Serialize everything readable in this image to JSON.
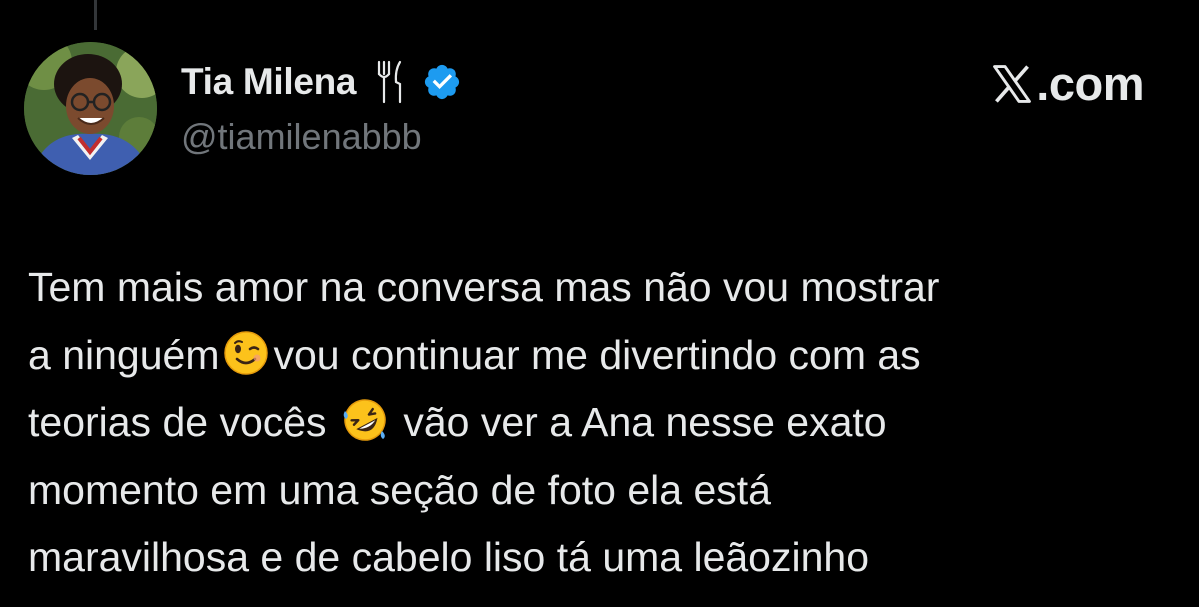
{
  "tweet": {
    "author": {
      "display_name": "Tia Milena",
      "name_emoji": "fork-and-knife-icon",
      "verified": true,
      "handle": "@tiamilenabbb",
      "avatar": "profile-photo"
    },
    "brand": {
      "label": ".com",
      "logo": "x-logo-icon"
    },
    "text_lines": {
      "line1": "Tem mais amor na conversa mas não vou mostrar",
      "line2_a": "a ninguém",
      "line2_b": "vou continuar me divertindo com as",
      "line3_a": "teorias de vocês",
      "line3_b": "vão ver a Ana nesse exato",
      "line4": "momento em uma seção de foto ela está",
      "line5": "maravilhosa e de cabelo liso tá uma leãozinho"
    },
    "emojis": {
      "emoji1": "winking-face-icon",
      "emoji2": "rolling-on-floor-laughing-icon"
    }
  },
  "colors": {
    "background": "#000000",
    "primary_text": "#e7e9ea",
    "secondary_text": "#71767b",
    "verified_blue": "#1d9bf0"
  }
}
